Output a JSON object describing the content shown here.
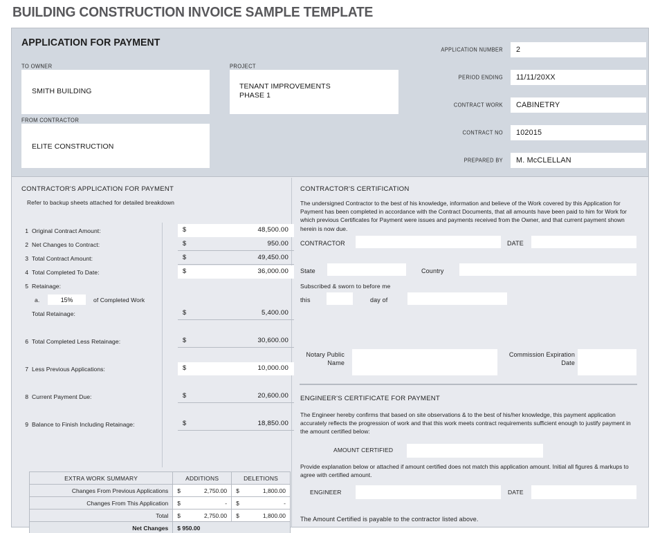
{
  "document": {
    "title": "BUILDING CONSTRUCTION INVOICE SAMPLE TEMPLATE",
    "application_heading": "APPLICATION FOR PAYMENT"
  },
  "header": {
    "to_owner_label": "TO OWNER",
    "to_owner_value": "SMITH BUILDING",
    "project_label": "PROJECT",
    "project_value": "TENANT IMPROVEMENTS\nPHASE 1",
    "from_contractor_label": "FROM CONTRACTOR",
    "from_contractor_value": "ELITE CONSTRUCTION",
    "fields": [
      {
        "label": "APPLICATION NUMBER",
        "value": "2"
      },
      {
        "label": "PERIOD ENDING",
        "value": "11/11/20XX"
      },
      {
        "label": "CONTRACT WORK",
        "value": "CABINETRY"
      },
      {
        "label": "CONTRACT NO",
        "value": "102015"
      },
      {
        "label": "PREPARED BY",
        "value": "M. McCLELLAN"
      }
    ]
  },
  "application": {
    "section_title": "CONTRACTOR'S APPLICATION FOR PAYMENT",
    "note": "Refer to backup sheets attached for detailed breakdown",
    "currency_symbol": "$",
    "lines": [
      {
        "num": "1",
        "label": "Original Contract Amount:",
        "amount": "48,500.00",
        "kind": "input"
      },
      {
        "num": "2",
        "label": "Net Changes to Contract:",
        "amount": "950.00",
        "kind": "calc"
      },
      {
        "num": "3",
        "label": "Total Contract Amount:",
        "amount": "49,450.00",
        "kind": "calc"
      },
      {
        "num": "4",
        "label": "Total Completed To Date:",
        "amount": "36,000.00",
        "kind": "input"
      },
      {
        "num": "5",
        "label": "Retainage:",
        "amount": "",
        "kind": "none"
      }
    ],
    "retainage_sub_letter": "a.",
    "retainage_percent": "15%",
    "retainage_of_label": "of Completed Work",
    "total_retainage_label": "Total Retainage:",
    "total_retainage_amount": "5,400.00",
    "lines2": [
      {
        "num": "6",
        "label": "Total Completed Less Retainage:",
        "amount": "30,600.00",
        "kind": "calc"
      },
      {
        "num": "7",
        "label": "Less Previous Applications:",
        "amount": "10,000.00",
        "kind": "input"
      },
      {
        "num": "8",
        "label": "Current Payment Due:",
        "amount": "20,600.00",
        "kind": "calc"
      },
      {
        "num": "9",
        "label": "Balance to Finish Including Retainage:",
        "amount": "18,850.00",
        "kind": "calc"
      }
    ]
  },
  "extra_work": {
    "headers": [
      "EXTRA WORK SUMMARY",
      "ADDITIONS",
      "DELETIONS"
    ],
    "rows": [
      {
        "label": "Changes From Previous Applications",
        "additions": "2,750.00",
        "deletions": "1,800.00"
      },
      {
        "label": "Changes From This Application",
        "additions": "-",
        "deletions": "-"
      },
      {
        "label": "Total",
        "additions": "2,750.00",
        "deletions": "1,800.00"
      }
    ],
    "net_label": "Net Changes",
    "net_currency": "$",
    "net_value": "950.00",
    "currency_symbol": "$"
  },
  "certification": {
    "section_title": "CONTRACTOR'S CERTIFICATION",
    "paragraph": "The undersigned Contractor to the best of his knowledge, information and believe of the Work covered by this Application for Payment has been completed in accordance with the Contract Documents, that all amounts have been paid to him for Work for which previous Certificates for Payment were issues and payments received from the Owner, and that current payment shown herein is now due.",
    "contractor_label": "CONTRACTOR",
    "contractor_value": "",
    "date_label": "DATE",
    "date_value": "",
    "state_label": "State",
    "state_value": "",
    "country_label": "Country",
    "country_value": "",
    "sworn_text": "Subscribed & sworn to before me",
    "this_label": "this",
    "this_value": "",
    "day_of_label": "day of",
    "day_of_value": "",
    "notary_label": "Notary\nPublic Name",
    "notary_value": "",
    "commission_label": "Commission\nExpiration Date",
    "commission_value": ""
  },
  "engineer": {
    "section_title": "ENGINEER'S CERTIFICATE FOR PAYMENT",
    "paragraph": "The Engineer hereby confirms that based on site observations & to the best of his/her knowledge, this payment application accurately reflects the progression of work and that this work meets contract requirements sufficient enough to justify payment in the amount certified below:",
    "amount_certified_label": "AMOUNT CERTIFIED",
    "amount_certified_value": "",
    "explanation": "Provide explanation below or attached if amount certified does not match this application amount. Initial all figures & markups to agree with certified amount.",
    "engineer_label": "ENGINEER",
    "engineer_value": "",
    "date_label": "DATE",
    "date_value": "",
    "footer_note": "The Amount Certified is payable to the contractor listed above."
  }
}
